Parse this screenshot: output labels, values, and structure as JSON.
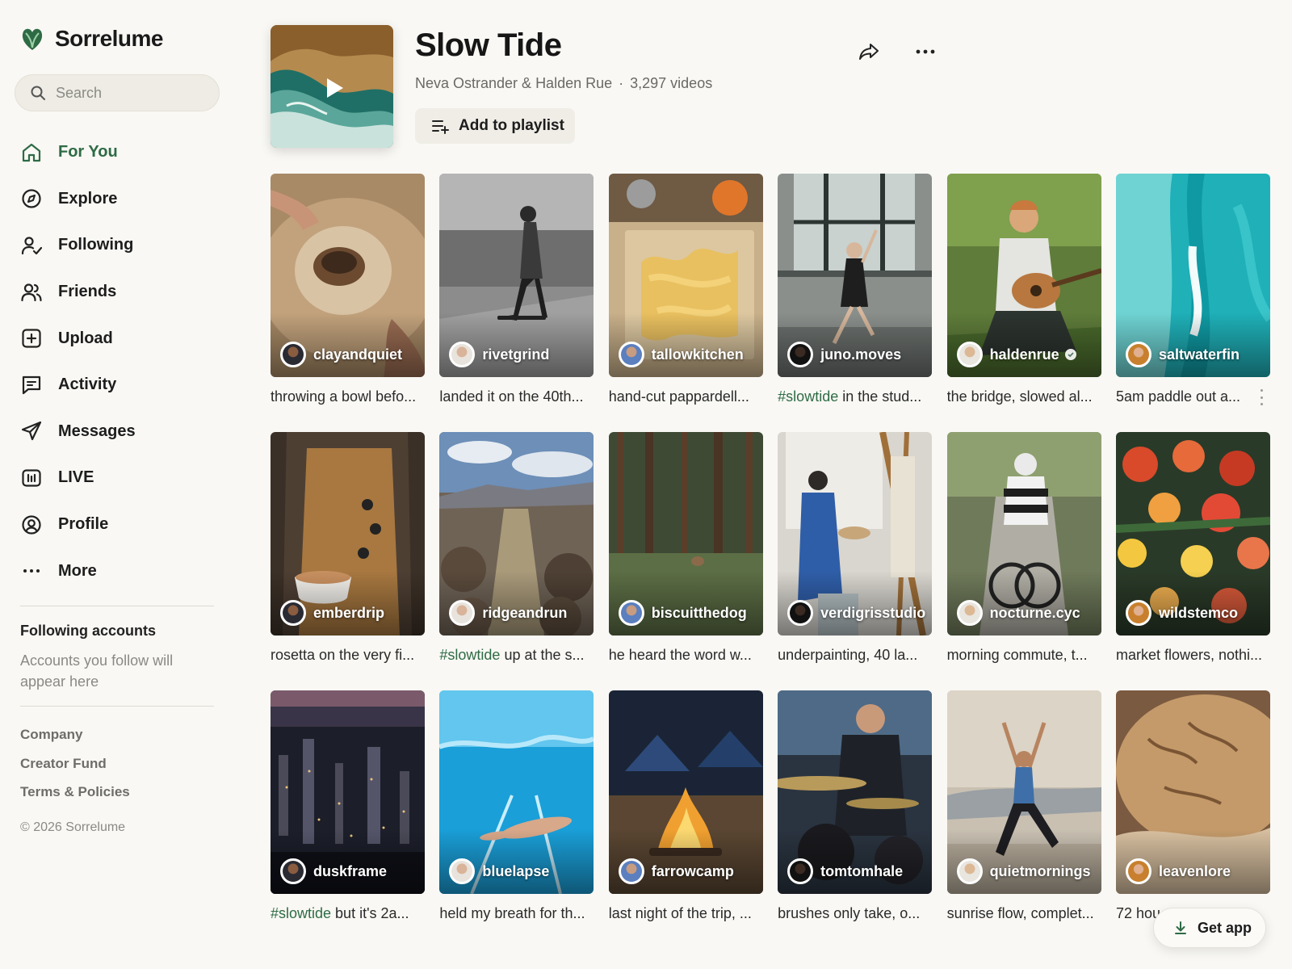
{
  "app": {
    "name": "Sorrelume",
    "accent": "#2e6b45"
  },
  "search": {
    "placeholder": "Search"
  },
  "nav": [
    {
      "label": "For You",
      "icon": "home-icon",
      "active": true
    },
    {
      "label": "Explore",
      "icon": "compass-icon"
    },
    {
      "label": "Following",
      "icon": "user-check-icon"
    },
    {
      "label": "Friends",
      "icon": "users-icon"
    },
    {
      "label": "Upload",
      "icon": "plus-square-icon"
    },
    {
      "label": "Activity",
      "icon": "message-square-icon"
    },
    {
      "label": "Messages",
      "icon": "send-icon"
    },
    {
      "label": "LIVE",
      "icon": "live-icon"
    },
    {
      "label": "Profile",
      "icon": "profile-icon"
    },
    {
      "label": "More",
      "icon": "more-horizontal-icon"
    }
  ],
  "following": {
    "title": "Following accounts",
    "description": "Accounts you follow will appear here"
  },
  "footer": {
    "links": [
      "Company",
      "Creator Fund",
      "Terms & Policies"
    ],
    "copyright": "© 2026 Sorrelume"
  },
  "playlist": {
    "title": "Slow Tide",
    "authors": "Neva Ostrander & Halden Rue",
    "separator": "·",
    "count": "3,297 videos",
    "add_label": "Add to playlist"
  },
  "videos": [
    {
      "handle": "clayandquiet",
      "caption": "throwing a bowl befo...",
      "tag": ""
    },
    {
      "handle": "rivetgrind",
      "caption": "landed it on the 40th...",
      "tag": ""
    },
    {
      "handle": "tallowkitchen",
      "caption": "hand-cut pappardell...",
      "tag": ""
    },
    {
      "handle": "juno.moves",
      "caption": " in the stud...",
      "tag": "#slowtide"
    },
    {
      "handle": "haldenrue",
      "caption": "the bridge, slowed al...",
      "tag": "",
      "verified": true
    },
    {
      "handle": "saltwaterfin",
      "caption": "5am paddle out a...",
      "tag": ""
    },
    {
      "handle": "emberdrip",
      "caption": "rosetta on the very fi...",
      "tag": ""
    },
    {
      "handle": "ridgeandrun",
      "caption": " up at the s...",
      "tag": "#slowtide"
    },
    {
      "handle": "biscuitthedog",
      "caption": "he heard the word w...",
      "tag": ""
    },
    {
      "handle": "verdigrisstudio",
      "caption": "underpainting, 40 la...",
      "tag": ""
    },
    {
      "handle": "nocturne.cyc",
      "caption": "morning commute, t...",
      "tag": ""
    },
    {
      "handle": "wildstemco",
      "caption": "market flowers, nothi...",
      "tag": ""
    },
    {
      "handle": "duskframe",
      "caption": " but it's 2a...",
      "tag": "#slowtide"
    },
    {
      "handle": "bluelapse",
      "caption": "held my breath for th...",
      "tag": ""
    },
    {
      "handle": "farrowcamp",
      "caption": "last night of the trip, ...",
      "tag": ""
    },
    {
      "handle": "tomtomhale",
      "caption": "brushes only take, o...",
      "tag": ""
    },
    {
      "handle": "quietmornings",
      "caption": "sunrise flow, complet...",
      "tag": ""
    },
    {
      "handle": "leavenlore",
      "caption": "72 hou",
      "tag": ""
    }
  ],
  "get_app": {
    "label": "Get app"
  }
}
